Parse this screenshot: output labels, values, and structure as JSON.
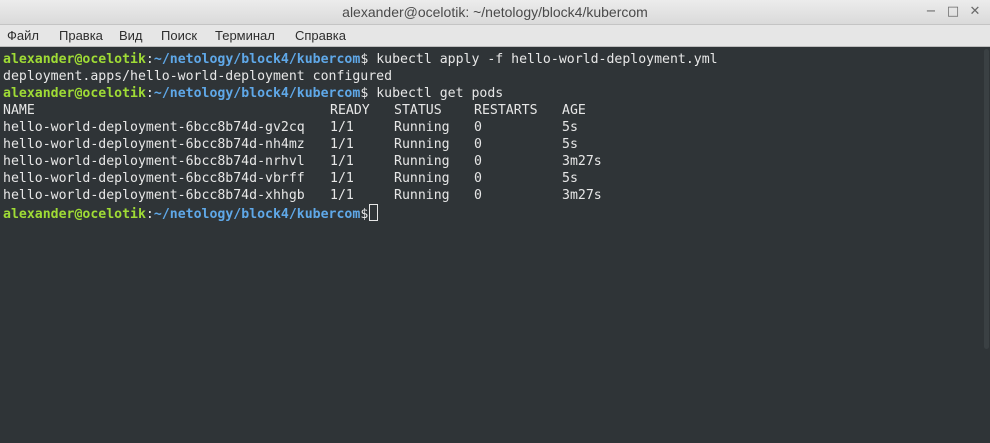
{
  "window": {
    "title": "alexander@ocelotik: ~/netology/block4/kubercom",
    "controls": {
      "minimize": "−",
      "maximize": "□",
      "close": "✕"
    }
  },
  "menu": [
    "Файл",
    "Правка",
    "Вид",
    "Поиск",
    "Терминал",
    "Справка"
  ],
  "prompt": {
    "user_host": "alexander@ocelotik",
    "separator": ":",
    "path": "~/netology/block4/kubercom",
    "symbol": "$"
  },
  "commands": [
    " kubectl apply -f hello-world-deployment.yml",
    " kubectl get pods"
  ],
  "apply_output": "deployment.apps/hello-world-deployment configured",
  "pods_table": {
    "headers": [
      "NAME",
      "READY",
      "STATUS",
      "RESTARTS",
      "AGE"
    ],
    "rows": [
      [
        "hello-world-deployment-6bcc8b74d-gv2cq",
        "1/1",
        "Running",
        "0",
        "5s"
      ],
      [
        "hello-world-deployment-6bcc8b74d-nh4mz",
        "1/1",
        "Running",
        "0",
        "5s"
      ],
      [
        "hello-world-deployment-6bcc8b74d-nrhvl",
        "1/1",
        "Running",
        "0",
        "3m27s"
      ],
      [
        "hello-world-deployment-6bcc8b74d-vbrff",
        "1/1",
        "Running",
        "0",
        "5s"
      ],
      [
        "hello-world-deployment-6bcc8b74d-xhhgb",
        "1/1",
        "Running",
        "0",
        "3m27s"
      ]
    ]
  },
  "colors": {
    "background": "#2f3437",
    "prompt_user": "#9fdb35",
    "prompt_path": "#5fa8e8",
    "text": "#e7e7e7"
  }
}
